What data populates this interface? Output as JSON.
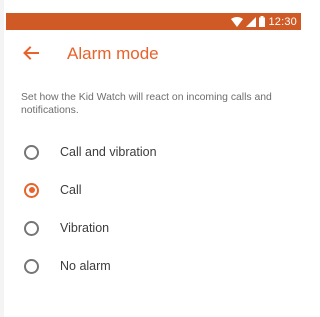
{
  "status_bar": {
    "time": "12:30",
    "icons": [
      "wifi-icon",
      "signal-icon",
      "battery-icon"
    ],
    "color": "#cf5a26"
  },
  "header": {
    "back_icon": "arrow-left-icon",
    "title": "Alarm mode",
    "accent_color": "#e8622b"
  },
  "main": {
    "description": "Set how the Kid Watch will react on incoming calls and notifications.",
    "options": [
      {
        "label": "Call and vibration",
        "selected": false
      },
      {
        "label": "Call",
        "selected": true
      },
      {
        "label": "Vibration",
        "selected": false
      },
      {
        "label": "No alarm",
        "selected": false
      }
    ]
  }
}
